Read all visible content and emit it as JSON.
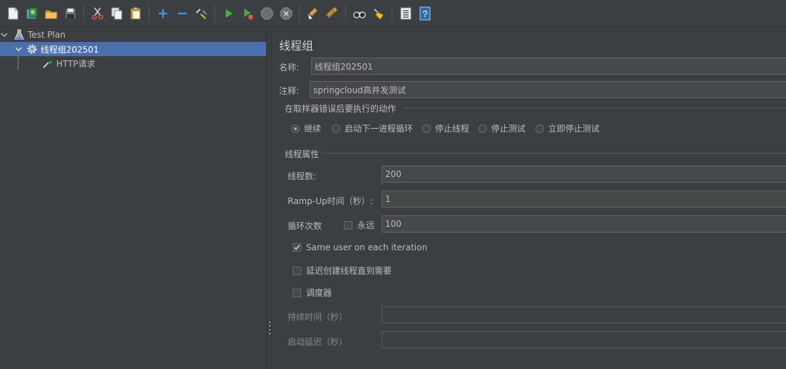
{
  "toolbar": {
    "buttons": [
      {
        "name": "new-icon",
        "color": "#e8e8e8"
      },
      {
        "name": "templates-icon",
        "color": "#4a90d9"
      },
      {
        "name": "open-icon",
        "color": "#e3a33a"
      },
      {
        "name": "save-icon",
        "color": "#9aa7b4"
      },
      {
        "name": "cut-icon",
        "color": "#d9534f"
      },
      {
        "name": "copy-icon",
        "color": "#cfcfcf"
      },
      {
        "name": "paste-icon",
        "color": "#d9a441"
      },
      {
        "name": "expand-icon",
        "color": "#4a90d9"
      },
      {
        "name": "collapse-icon",
        "color": "#4a90d9"
      },
      {
        "name": "toggle-icon",
        "color": "#9acd32"
      },
      {
        "name": "start-icon",
        "color": "#3cb043"
      },
      {
        "name": "start-no-pause-icon",
        "color": "#3cb043"
      },
      {
        "name": "stop-icon",
        "color": "#8a8a8a"
      },
      {
        "name": "shutdown-icon",
        "color": "#8a8a8a"
      },
      {
        "name": "clear-icon",
        "color": "#c9a05a"
      },
      {
        "name": "clear-all-icon",
        "color": "#c9a05a"
      },
      {
        "name": "search-icon",
        "color": "#cccccc"
      },
      {
        "name": "reset-search-icon",
        "color": "#f0c419"
      },
      {
        "name": "function-helper-icon",
        "color": "#e0e0e0"
      },
      {
        "name": "help-icon",
        "color": "#4a90d9"
      }
    ]
  },
  "tree": {
    "items": [
      {
        "label": "Test Plan"
      },
      {
        "label": "线程组202501"
      },
      {
        "label": "HTTP请求"
      }
    ]
  },
  "panel": {
    "title": "线程组",
    "name_label": "名称:",
    "name_value": "线程组202501",
    "comment_label": "注释:",
    "comment_value": "springcloud高并发测试",
    "error_group_title": "在取样器错误后要执行的动作",
    "error_actions": [
      {
        "label": "继续",
        "selected": true
      },
      {
        "label": "启动下一进程循环",
        "selected": false
      },
      {
        "label": "停止线程",
        "selected": false
      },
      {
        "label": "停止测试",
        "selected": false
      },
      {
        "label": "立即停止测试",
        "selected": false
      }
    ],
    "thread_group_title": "线程属性",
    "threads_label": "线程数:",
    "threads_value": "200",
    "rampup_label": "Ramp-Up时间（秒）:",
    "rampup_value": "1",
    "loop_label": "循环次数",
    "forever_label": "永远",
    "forever_checked": false,
    "loop_value": "100",
    "same_user_label": "Same user on each iteration",
    "same_user_checked": true,
    "delay_create_label": "延迟创建线程直到需要",
    "delay_create_checked": false,
    "scheduler_label": "调度器",
    "scheduler_checked": false,
    "duration_label": "持续时间（秒）",
    "duration_value": "",
    "startup_delay_label": "启动延迟（秒）",
    "startup_delay_value": ""
  },
  "colors": {
    "background": "#3c3f41",
    "selection": "#4b6eaf",
    "field_bg": "#45494a",
    "field_border": "#646464",
    "text": "#bbbbbb"
  }
}
